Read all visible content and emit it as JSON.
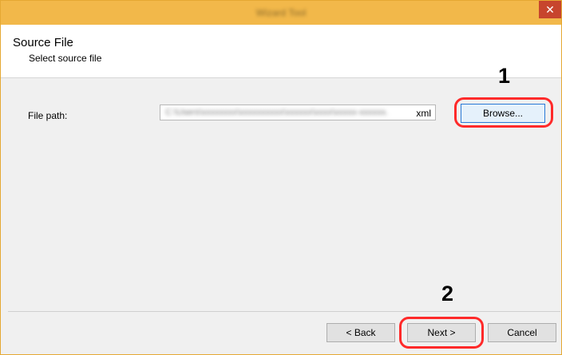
{
  "window": {
    "title": "Wizard Tool",
    "close_glyph": "✕"
  },
  "header": {
    "title": "Source File",
    "subtitle": "Select source file"
  },
  "form": {
    "file_path_label": "File path:",
    "file_path_value_blurred": "C:\\Users\\xxxxxxxx\\xxxxxxxxxx\\xxxxxx\\xxxx\\xxxxx-xxxxxx.",
    "file_path_extension": "xml",
    "browse_label": "Browse..."
  },
  "footer": {
    "back_label": "< Back",
    "next_label": "Next >",
    "cancel_label": "Cancel"
  },
  "annotations": {
    "step1": "1",
    "step2": "2",
    "highlight_color": "#ff2a2a"
  },
  "colors": {
    "titlebar": "#f2b84a",
    "close_button": "#c7452d",
    "dialog_background": "#f0f0f0"
  }
}
